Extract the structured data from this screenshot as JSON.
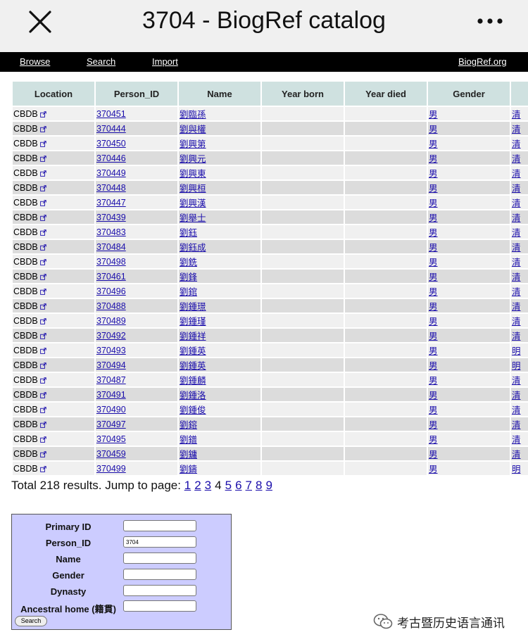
{
  "header": {
    "title": "3704 - BiogRef catalog",
    "close_icon": "close-icon",
    "more_icon": "more-icon"
  },
  "nav": {
    "browse": "Browse",
    "search": "Search",
    "import": "Import",
    "site": "BiogRef.org"
  },
  "table": {
    "columns": [
      "Location",
      "Person_ID",
      "Name",
      "Year born",
      "Year died",
      "Gender",
      ""
    ],
    "rows": [
      {
        "location": "CBDB",
        "id": "370451",
        "name": "劉臨孫",
        "born": "",
        "died": "",
        "gender": "男",
        "dynasty": "清"
      },
      {
        "location": "CBDB",
        "id": "370444",
        "name": "劉與權",
        "born": "",
        "died": "",
        "gender": "男",
        "dynasty": "清"
      },
      {
        "location": "CBDB",
        "id": "370450",
        "name": "劉興第",
        "born": "",
        "died": "",
        "gender": "男",
        "dynasty": "清"
      },
      {
        "location": "CBDB",
        "id": "370446",
        "name": "劉興元",
        "born": "",
        "died": "",
        "gender": "男",
        "dynasty": "清"
      },
      {
        "location": "CBDB",
        "id": "370449",
        "name": "劉興東",
        "born": "",
        "died": "",
        "gender": "男",
        "dynasty": "清"
      },
      {
        "location": "CBDB",
        "id": "370448",
        "name": "劉興桓",
        "born": "",
        "died": "",
        "gender": "男",
        "dynasty": "清"
      },
      {
        "location": "CBDB",
        "id": "370447",
        "name": "劉興漢",
        "born": "",
        "died": "",
        "gender": "男",
        "dynasty": "清"
      },
      {
        "location": "CBDB",
        "id": "370439",
        "name": "劉舉士",
        "born": "",
        "died": "",
        "gender": "男",
        "dynasty": "清"
      },
      {
        "location": "CBDB",
        "id": "370483",
        "name": "劉鈺",
        "born": "",
        "died": "",
        "gender": "男",
        "dynasty": "清"
      },
      {
        "location": "CBDB",
        "id": "370484",
        "name": "劉鈺成",
        "born": "",
        "died": "",
        "gender": "男",
        "dynasty": "清"
      },
      {
        "location": "CBDB",
        "id": "370498",
        "name": "劉銑",
        "born": "",
        "died": "",
        "gender": "男",
        "dynasty": "清"
      },
      {
        "location": "CBDB",
        "id": "370461",
        "name": "劉鋒",
        "born": "",
        "died": "",
        "gender": "男",
        "dynasty": "清"
      },
      {
        "location": "CBDB",
        "id": "370496",
        "name": "劉錧",
        "born": "",
        "died": "",
        "gender": "男",
        "dynasty": "清"
      },
      {
        "location": "CBDB",
        "id": "370488",
        "name": "劉鍾璟",
        "born": "",
        "died": "",
        "gender": "男",
        "dynasty": "清"
      },
      {
        "location": "CBDB",
        "id": "370489",
        "name": "劉鍾瑾",
        "born": "",
        "died": "",
        "gender": "男",
        "dynasty": "清"
      },
      {
        "location": "CBDB",
        "id": "370492",
        "name": "劉鍾祥",
        "born": "",
        "died": "",
        "gender": "男",
        "dynasty": "清"
      },
      {
        "location": "CBDB",
        "id": "370493",
        "name": "劉鍾英",
        "born": "",
        "died": "",
        "gender": "男",
        "dynasty": "明"
      },
      {
        "location": "CBDB",
        "id": "370494",
        "name": "劉鍾英",
        "born": "",
        "died": "",
        "gender": "男",
        "dynasty": "明"
      },
      {
        "location": "CBDB",
        "id": "370487",
        "name": "劉鍾麟",
        "born": "",
        "died": "",
        "gender": "男",
        "dynasty": "清"
      },
      {
        "location": "CBDB",
        "id": "370491",
        "name": "劉鍾洛",
        "born": "",
        "died": "",
        "gender": "男",
        "dynasty": "清"
      },
      {
        "location": "CBDB",
        "id": "370490",
        "name": "劉鍾俊",
        "born": "",
        "died": "",
        "gender": "男",
        "dynasty": "清"
      },
      {
        "location": "CBDB",
        "id": "370497",
        "name": "劉鎔",
        "born": "",
        "died": "",
        "gender": "男",
        "dynasty": "清"
      },
      {
        "location": "CBDB",
        "id": "370495",
        "name": "劉鐠",
        "born": "",
        "died": "",
        "gender": "男",
        "dynasty": "清"
      },
      {
        "location": "CBDB",
        "id": "370459",
        "name": "劉鏞",
        "born": "",
        "died": "",
        "gender": "男",
        "dynasty": "清"
      },
      {
        "location": "CBDB",
        "id": "370499",
        "name": "劉鑄",
        "born": "",
        "died": "",
        "gender": "男",
        "dynasty": "明"
      }
    ]
  },
  "pager": {
    "text": "Total 218 results. Jump to page:",
    "pages": [
      "1",
      "2",
      "3",
      "4",
      "5",
      "6",
      "7",
      "8",
      "9"
    ],
    "current": "4"
  },
  "search_form": {
    "fields": [
      {
        "label": "Primary ID",
        "value": ""
      },
      {
        "label": "Person_ID",
        "value": "3704"
      },
      {
        "label": "Name",
        "value": ""
      },
      {
        "label": "Gender",
        "value": ""
      },
      {
        "label": "Dynasty",
        "value": ""
      },
      {
        "label": "Ancestral home (籍貫)",
        "value": ""
      }
    ],
    "button": "Search"
  },
  "watermark": {
    "text": "考古暨历史语言通讯"
  },
  "colors": {
    "navbar": "#000000",
    "table_header": "#cfe1e0",
    "row_odd": "#f0f0f0",
    "row_even": "#dcdcdc",
    "link": "#1a0dab",
    "search_bg": "#ccccff"
  }
}
